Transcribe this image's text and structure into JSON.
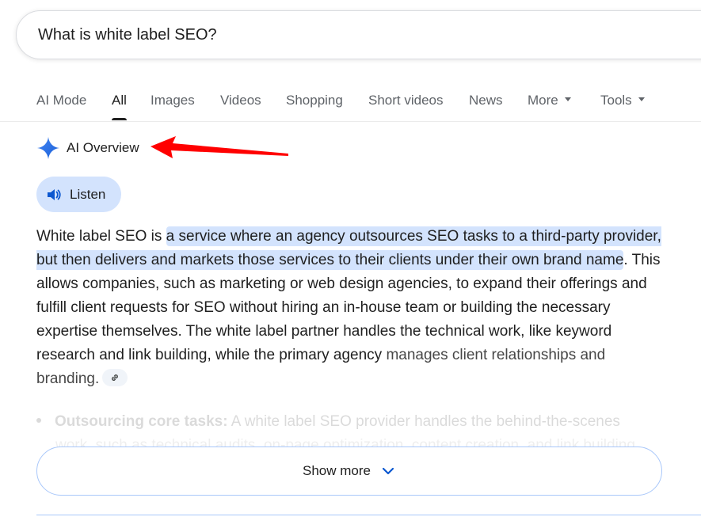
{
  "search": {
    "query": "What is white label SEO?"
  },
  "tabs": [
    {
      "label": "AI Mode",
      "active": false
    },
    {
      "label": "All",
      "active": true
    },
    {
      "label": "Images",
      "active": false
    },
    {
      "label": "Videos",
      "active": false
    },
    {
      "label": "Shopping",
      "active": false
    },
    {
      "label": "Short videos",
      "active": false
    },
    {
      "label": "News",
      "active": false
    },
    {
      "label": "More",
      "active": false,
      "dropdown": true
    },
    {
      "label": "Tools",
      "active": false,
      "dropdown": true
    }
  ],
  "ai_overview": {
    "title": "AI Overview",
    "icon": "sparkle-icon",
    "listen_label": "Listen",
    "answer": {
      "intro": "White label SEO is ",
      "highlight": "a service where an agency outsources SEO tasks to a third-party provider, but then delivers and markets those services to their clients under their own brand name",
      "body": ". This allows companies, such as marketing or web design agencies, to expand their offerings and fulfill client requests for SEO without hiring an in-house team or building the necessary expertise themselves. The white label partner handles the technical work, like keyword research and link building, while the primary agency ",
      "tail": "manages client relationships and branding."
    },
    "bullet": {
      "bold": "Outsourcing core tasks:",
      "text": " A white label SEO provider handles the behind-the-scenes",
      "line2": "work, such as technical audits, on-page optimization, content creation, and link building."
    },
    "show_more_label": "Show more"
  },
  "colors": {
    "highlight": "#d3e3fd",
    "annotation_arrow": "#ff0000",
    "sparkle": "#1a73e8",
    "chevron": "#0b57d0"
  }
}
